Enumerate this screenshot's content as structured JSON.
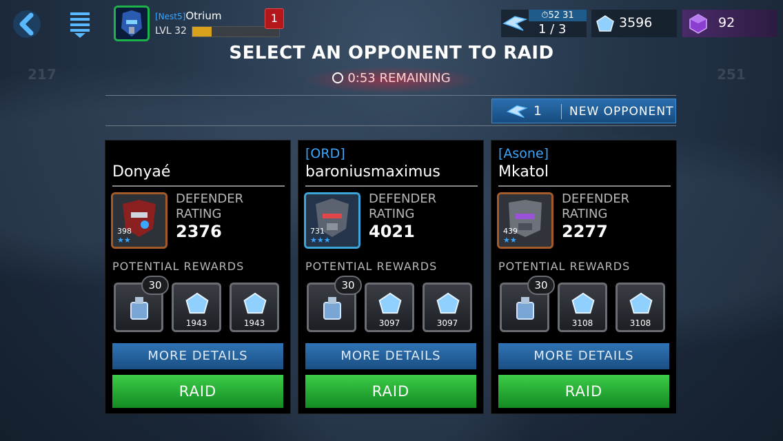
{
  "header": {
    "player": {
      "tag": "[Nest5]",
      "name": "Otrium",
      "level": "LVL 32",
      "xp_fraction": 0.22
    },
    "notification_count": "1",
    "energy": {
      "timer": "52 31",
      "count": "1 / 3"
    },
    "crystals": "3596",
    "gems": "92"
  },
  "background": {
    "left_number": "217",
    "right_number": "251"
  },
  "title": "SELECT AN OPPONENT TO RAID",
  "remaining": "0:53 REMAINING",
  "new_opponent": {
    "count": "1",
    "label": "NEW OPPONENT"
  },
  "labels": {
    "defender_rating": "DEFENDER RATING",
    "potential_rewards": "POTENTIAL REWARDS",
    "more_details": "MORE DETAILS",
    "raid": "RAID"
  },
  "opponents": [
    {
      "tag": "",
      "name": "Donyaé",
      "bot_level": "398",
      "defender_rating": "2376",
      "reward_badge": "30",
      "reward_values": [
        "1943",
        "1943"
      ]
    },
    {
      "tag": "[ORD]",
      "name": "baroniusmaximus",
      "bot_level": "731",
      "defender_rating": "4021",
      "reward_badge": "30",
      "reward_values": [
        "3097",
        "3097"
      ]
    },
    {
      "tag": "[Asone]",
      "name": "Mkatol",
      "bot_level": "439",
      "defender_rating": "2277",
      "reward_badge": "30",
      "reward_values": [
        "3108",
        "3108"
      ]
    }
  ],
  "colors": {
    "raid_green": "#2fb83a",
    "details_blue": "#2a6ea8",
    "accent_blue": "#3aa7ff",
    "gem_purple": "#8a3fd1"
  }
}
